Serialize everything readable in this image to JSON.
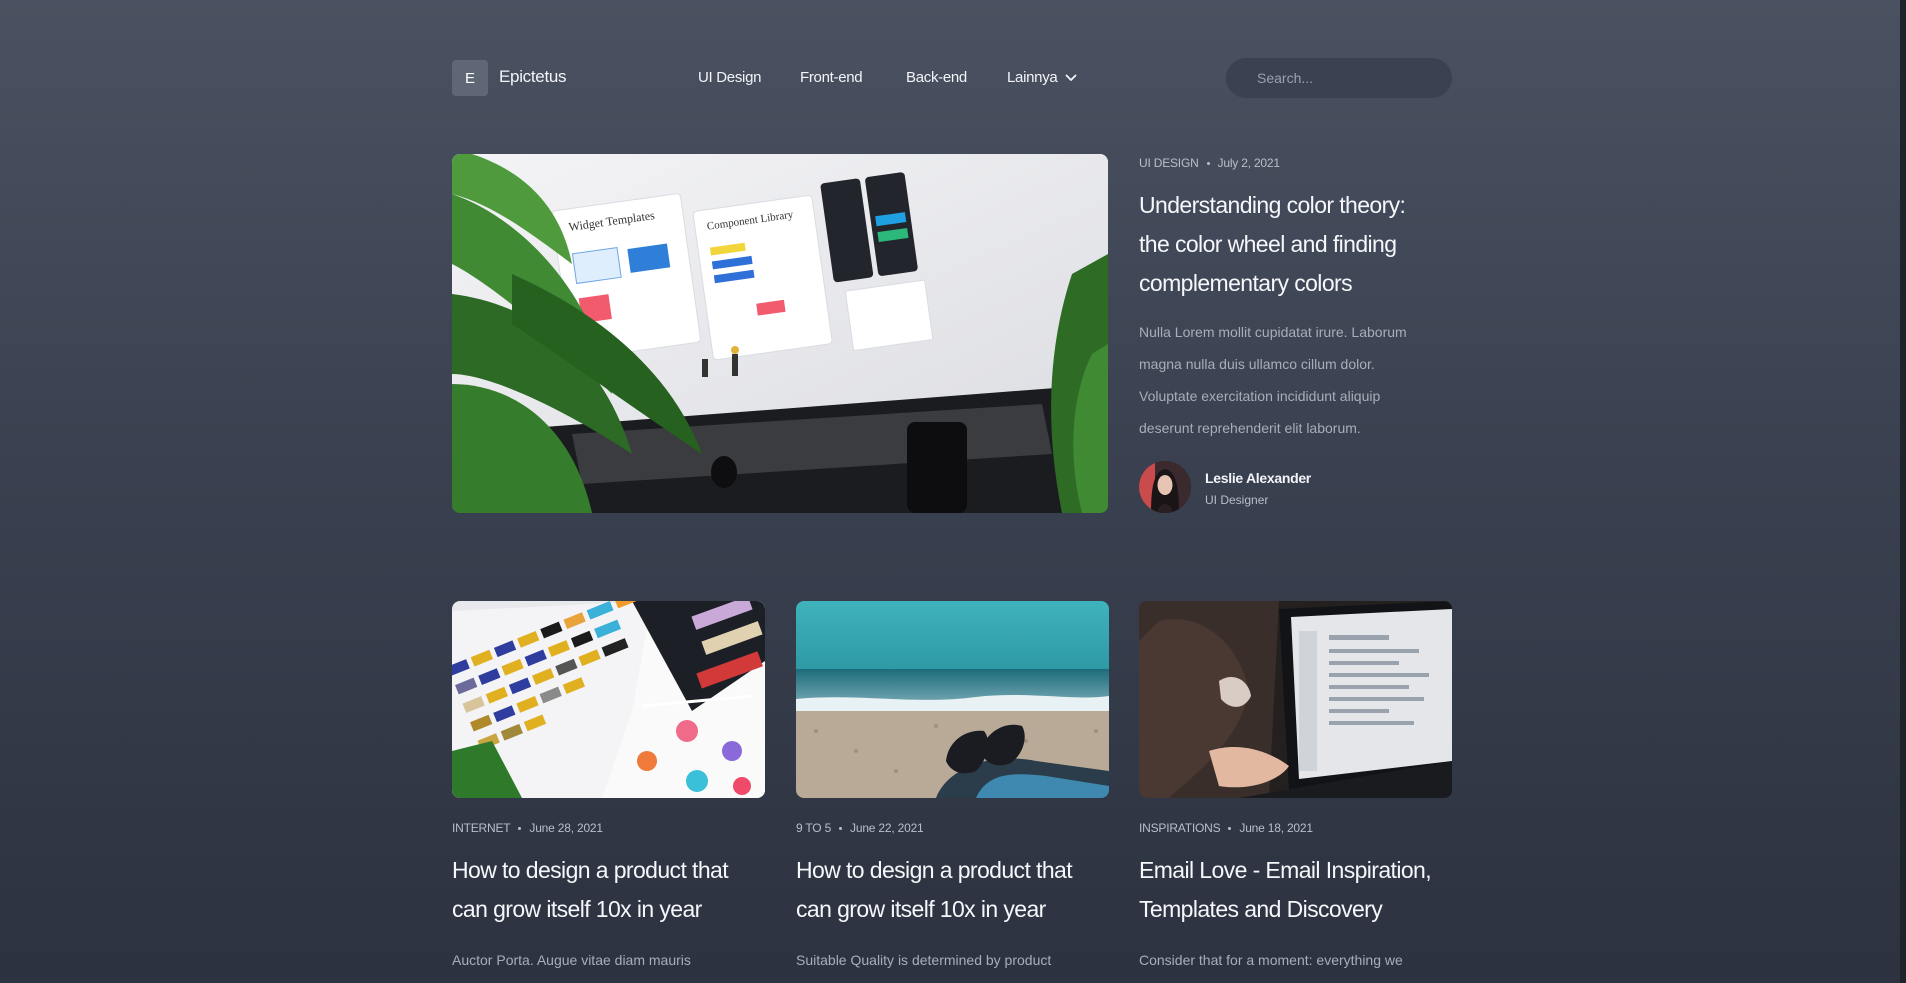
{
  "brand": {
    "logo_letter": "E",
    "name": "Epictetus"
  },
  "nav": {
    "items": [
      "UI Design",
      "Front-end",
      "Back-end"
    ],
    "more_label": "Lainnya"
  },
  "search": {
    "placeholder": "Search..."
  },
  "hero": {
    "category": "UI DESIGN",
    "date": "July 2, 2021",
    "title": "Understanding color theory: the color wheel and finding complementary colors",
    "excerpt": "Nulla Lorem mollit cupidatat irure. Laborum magna nulla duis ullamco cillum dolor. Voluptate exercitation incididunt aliquip deserunt reprehenderit elit laborum.",
    "author": {
      "name": "Leslie Alexander",
      "role": "UI Designer"
    }
  },
  "cards": [
    {
      "category": "INTERNET",
      "date": "June 28, 2021",
      "title": "How to design a product that can grow itself 10x in year",
      "excerpt": "Auctor Porta. Augue vitae diam mauris"
    },
    {
      "category": "9 TO 5",
      "date": "June 22, 2021",
      "title": "How to design a product that can grow itself 10x in year",
      "excerpt": "Suitable Quality is determined by product"
    },
    {
      "category": "INSPIRATIONS",
      "date": "June 18, 2021",
      "title": "Email Love - Email Inspiration, Templates and Discovery",
      "excerpt": "Consider that for a moment: everything we"
    }
  ],
  "colors": {
    "background": "#3a4150",
    "accent": "#5f6776",
    "text": "#f2f4f8"
  }
}
